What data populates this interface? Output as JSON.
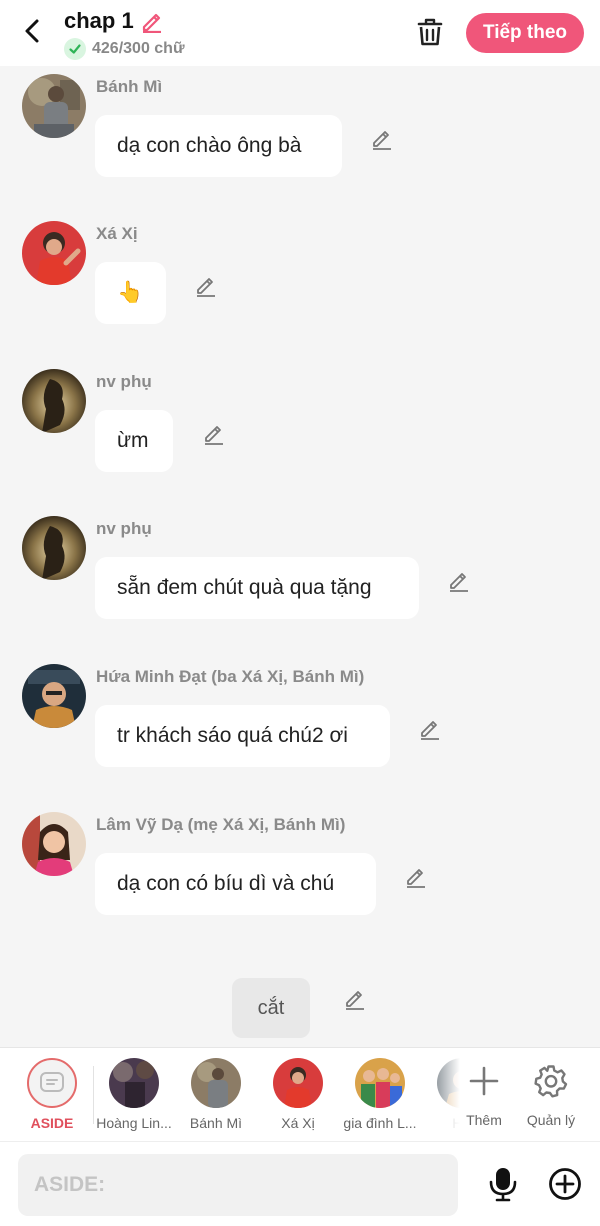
{
  "header": {
    "title": "chap 1",
    "word_count": "426/300 chữ",
    "next_label": "Tiếp theo"
  },
  "messages": [
    {
      "sender": "Bánh Mì",
      "text": "dạ con chào ông bà"
    },
    {
      "sender": "Xá Xị",
      "text": "👆"
    },
    {
      "sender": "nv phụ",
      "text": "ừm"
    },
    {
      "sender": "nv phụ",
      "text": "sẵn đem chút quà qua tặng"
    },
    {
      "sender": "Hứa Minh Đạt (ba Xá Xị, Bánh Mì)",
      "text": "tr khách sáo quá chú2 ơi"
    },
    {
      "sender": "Lâm Vỹ Dạ (mẹ Xá Xị, Bánh Mì)",
      "text": "dạ con có bíu dì và chú"
    }
  ],
  "cut": {
    "text": "cắt"
  },
  "characters": [
    {
      "label": "ASIDE"
    },
    {
      "label": "Hoàng Lin..."
    },
    {
      "label": "Bánh Mì"
    },
    {
      "label": "Xá Xị"
    },
    {
      "label": "gia đình L..."
    },
    {
      "label": "Hứ"
    }
  ],
  "tools": {
    "add_label": "Thêm",
    "manage_label": "Quản lý"
  },
  "input": {
    "placeholder": "ASIDE:"
  },
  "colors": {
    "accent": "#f0567a",
    "background": "#f5f5f5",
    "bubble": "#ffffff",
    "check": "#2fb457"
  }
}
